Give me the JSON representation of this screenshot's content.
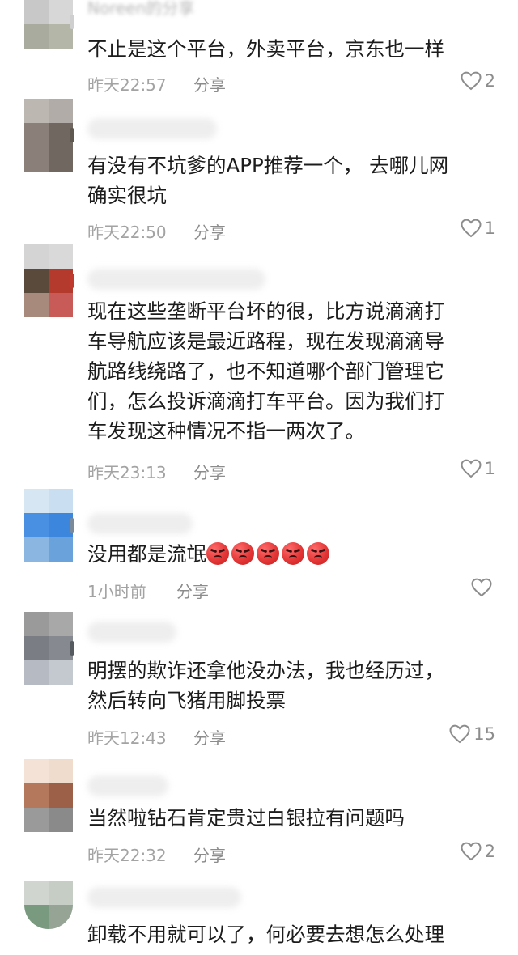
{
  "comments": [
    {
      "username": "Noreen的分享",
      "avatar_colors": [
        "#c8c8c8",
        "#d7d7d7",
        "#a9ab9e",
        "#b4b6a8"
      ],
      "text_lines": [
        "不止是这个平台，外卖平台，京东也一样"
      ],
      "time": "昨天22:57",
      "reply": "分享",
      "likes": "2"
    },
    {
      "username": "",
      "avatar_colors": [
        "#bdb7b2",
        "#b2aca8",
        "#8a7f79",
        "#6f6760"
      ],
      "text_lines": [
        "有没有不坑爹的APP推荐一个，  去哪儿网",
        "确实很坑"
      ],
      "time": "昨天22:50",
      "reply": "分享",
      "likes": "1"
    },
    {
      "username": "",
      "avatar_colors": [
        "#d4d4d4",
        "#d9d9d9",
        "#5a4a3c",
        "#b43a2e",
        "#a88a7c",
        "#c85a58"
      ],
      "text_lines": [
        "现在这些垄断平台坏的很，比方说滴滴打",
        "车导航应该是最近路程，现在发现滴滴导",
        "航路线绕路了，也不知道哪个部门管理它",
        "们，怎么投诉滴滴打车平台。因为我们打",
        "车发现这种情况不指一两次了。"
      ],
      "time": "昨天23:13",
      "reply": "分享",
      "likes": "1"
    },
    {
      "username": "",
      "avatar_colors": [
        "#d6e6f2",
        "#c9def0",
        "#4a90e2",
        "#3d86de",
        "#8bb6e2",
        "#6aa3dc"
      ],
      "text_lines": [
        "没用都是流氓"
      ],
      "emoji_count": 5,
      "time": "1小时前",
      "reply": "分享",
      "likes": ""
    },
    {
      "username": "",
      "avatar_colors": [
        "#9a9a9a",
        "#a8a8a8",
        "#7a7e84",
        "#868a90",
        "#b6bac2",
        "#c4c8cf"
      ],
      "text_lines": [
        "明摆的欺诈还拿他没办法，我也经历过，",
        "然后转向飞猪用脚投票"
      ],
      "time": "昨天12:43",
      "reply": "分享",
      "likes": "15"
    },
    {
      "username": "",
      "avatar_colors": [
        "#f4e2d6",
        "#f0dccd",
        "#b4785c",
        "#9c6048",
        "#9a9a9a",
        "#8a8a8a"
      ],
      "text_lines": [
        "当然啦钻石肯定贵过白银拉有问题吗"
      ],
      "time": "昨天22:32",
      "reply": "分享",
      "likes": "2"
    },
    {
      "username": "",
      "avatar_colors": [
        "#d0d6cf",
        "#c6cdc5",
        "#7a9a80",
        "#96a496"
      ],
      "text_lines": [
        "卸载不用就可以了，何必要去想怎么处理"
      ],
      "time": "",
      "reply": "",
      "likes": ""
    }
  ]
}
